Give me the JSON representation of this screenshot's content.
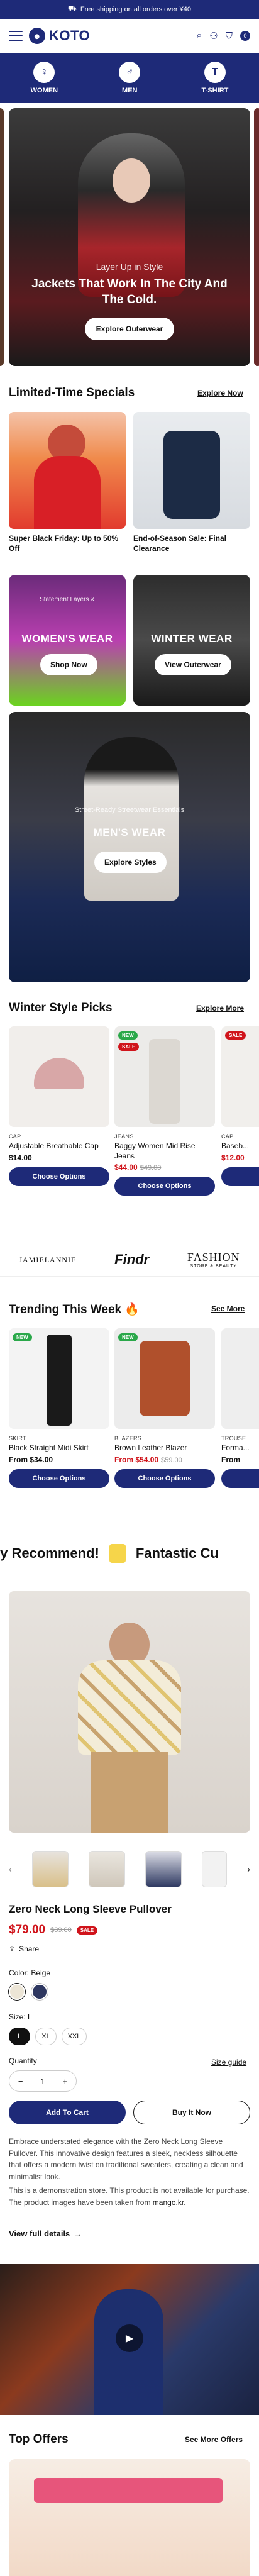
{
  "announcement": {
    "text": "Free shipping on all orders over ¥40"
  },
  "header": {
    "logo": "KOTO",
    "cart_count": "0"
  },
  "categories": [
    {
      "label": "WOMEN",
      "icon": "dress-icon"
    },
    {
      "label": "MEN",
      "icon": "shirt-icon"
    },
    {
      "label": "T-SHIRT",
      "icon": "tshirt-icon"
    }
  ],
  "hero": {
    "subtitle": "Layer Up in Style",
    "title": "Jackets That Work In The City And The Cold.",
    "button": "Explore Outerwear"
  },
  "limited": {
    "heading": "Limited-Time Specials",
    "link": "Explore Now",
    "items": [
      {
        "title": "Super Black Friday: Up to 50% Off"
      },
      {
        "title": "End-of-Season Sale: Final Clearance"
      }
    ]
  },
  "category_tiles": [
    {
      "eyebrow": "Statement Layers &",
      "title": "WOMEN'S WEAR",
      "button": "Shop Now"
    },
    {
      "eyebrow": "",
      "title": "WINTER WEAR",
      "button": "View Outerwear"
    },
    {
      "eyebrow": "Street-Ready Streetwear Essentials",
      "title": "MEN'S WEAR",
      "button": "Explore Styles"
    }
  ],
  "winter": {
    "heading": "Winter Style Picks",
    "link": "Explore More",
    "products": [
      {
        "vendor": "CAP",
        "title": "Adjustable Breathable Cap",
        "price": "$14.00",
        "old": "",
        "button": "Choose Options",
        "badges": []
      },
      {
        "vendor": "JEANS",
        "title": "Baggy Women Mid Rise Jeans",
        "price": "$44.00",
        "old": "$49.00",
        "button": "Choose Options",
        "badges": [
          "NEW",
          "SALE"
        ]
      },
      {
        "vendor": "CAP",
        "title": "Baseb...",
        "price": "$12.00",
        "old": "",
        "button": "",
        "badges": [
          "SALE"
        ]
      }
    ]
  },
  "brands": [
    "JAMIELANNIE",
    "Findr",
    "FASHION"
  ],
  "brands_sub": "STORE & BEAUTY",
  "trending": {
    "heading": "Trending This Week 🔥",
    "link": "See More",
    "products": [
      {
        "vendor": "SKIRT",
        "title": "Black Straight Midi Skirt",
        "price": "From $34.00",
        "old": "",
        "button": "Choose Options",
        "badges": [
          "NEW"
        ]
      },
      {
        "vendor": "BLAZERS",
        "title": "Brown Leather Blazer",
        "price": "From $54.00",
        "old": "$59.00",
        "button": "Choose Options",
        "badges": [
          "NEW"
        ]
      },
      {
        "vendor": "TROUSE",
        "title": "Forma...",
        "price": "From",
        "old": "",
        "button": "",
        "badges": []
      }
    ]
  },
  "marquee": {
    "left": "ly Recommend!",
    "right": "Fantastic Cu"
  },
  "product": {
    "title": "Zero Neck Long Sleeve Pullover",
    "price": "$79.00",
    "old_price": "$89.00",
    "sale_badge": "SALE",
    "share": "Share",
    "color_label": "Color: Beige",
    "size_label": "Size: L",
    "sizes": [
      "L",
      "XL",
      "XXL"
    ],
    "quantity_label": "Quantity",
    "quantity": "1",
    "size_guide": "Size guide",
    "add_to_cart": "Add To Cart",
    "buy_now": "Buy It Now",
    "desc1": "Embrace understated elegance with the Zero Neck Long Sleeve Pullover. This innovative design features a sleek, neckless silhouette that offers a modern twist on traditional sweaters, creating a clean and minimalist look.",
    "desc2": "This is a demonstration store. This product is not available for purchase. The product images have been taken from ",
    "desc2_link": "mango.kr",
    "desc2_end": ".",
    "full_details": "View full details"
  },
  "top_offers": {
    "heading": "Top Offers",
    "link": "See More Offers"
  }
}
